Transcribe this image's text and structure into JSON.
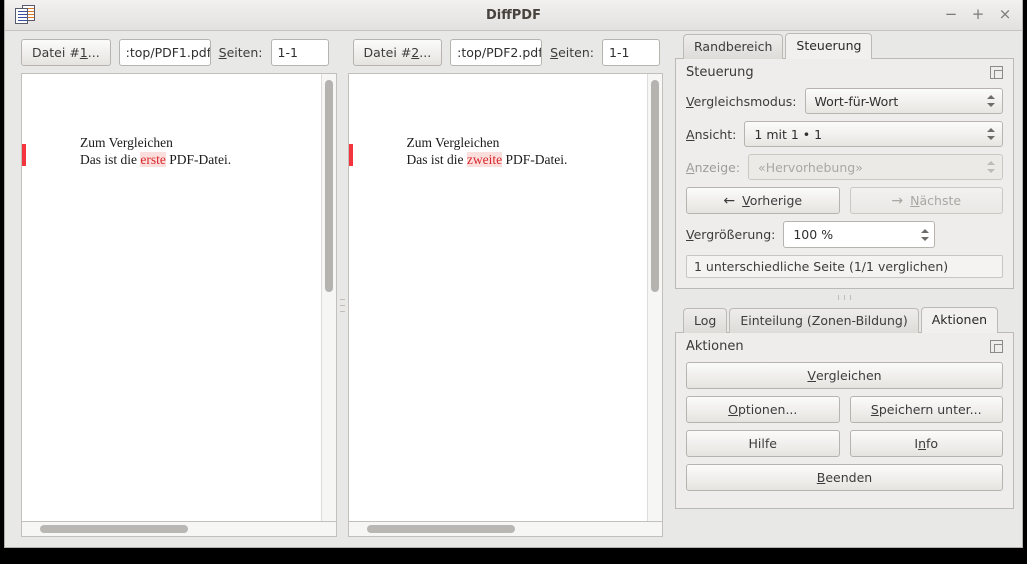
{
  "window": {
    "title": "DiffPDF",
    "icon": "documents-icon",
    "buttons": {
      "minimize": "−",
      "maximize": "+",
      "close": "×"
    }
  },
  "toolbar": {
    "file1": {
      "button_label": "Datei #1...",
      "button_mnemonic": "1",
      "filename": ":top/PDF1.pdf",
      "pages_label": "Seiten:",
      "pages_mnemonic": "S",
      "pages_value": "1-1"
    },
    "file2": {
      "button_label": "Datei #2...",
      "button_mnemonic": "2",
      "filename": ":top/PDF2.pdf",
      "pages_label": "Seiten:",
      "pages_mnemonic": "S",
      "pages_value": "1-1"
    }
  },
  "viewers": [
    {
      "name": "left-document-pane",
      "line1": "Zum Vergleichen",
      "line2_before": "Das ist die ",
      "line2_highlight": "erste",
      "line2_after": " PDF-Datei.",
      "has_diff_marker": true
    },
    {
      "name": "right-document-pane",
      "line1": "Zum Vergleichen",
      "line2_before": "Das ist die ",
      "line2_highlight": "zweite",
      "line2_after": " PDF-Datei.",
      "has_diff_marker": true
    }
  ],
  "colors": {
    "diff_marker": "#f4353e",
    "highlight_bg": "#fcdfdc",
    "highlight_text": "#d8252b",
    "window_bg": "#e8e8e7"
  },
  "top_dock": {
    "tabs": [
      {
        "label": "Randbereich",
        "active": false
      },
      {
        "label": "Steuerung",
        "active": true
      }
    ],
    "panel_title": "Steuerung",
    "float_icon": "undock-icon",
    "fields": {
      "mode_label": "Vergleichsmodus:",
      "mode_mnemonic": "V",
      "mode_value": "Wort-für-Wort",
      "view_label": "Ansicht:",
      "view_mnemonic": "A",
      "view_value": "1 mit 1 • 1",
      "display_label": "Anzeige:",
      "display_mnemonic": "A",
      "display_value": "«Hervorhebung»",
      "display_disabled": true,
      "zoom_label": "Vergrößerung:",
      "zoom_mnemonic": "V",
      "zoom_value": "100 %"
    },
    "nav": {
      "prev_label": "Vorherige",
      "prev_mnemonic": "V",
      "prev_arrow": "←",
      "next_label": "Nächste",
      "next_mnemonic": "N",
      "next_arrow": "→",
      "next_disabled": true
    },
    "status": "1 unterschiedliche Seite (1/1 verglichen)"
  },
  "bottom_dock": {
    "tabs": [
      {
        "label": "Log",
        "active": false
      },
      {
        "label": "Einteilung (Zonen-Bildung)",
        "active": false
      },
      {
        "label": "Aktionen",
        "active": true
      }
    ],
    "panel_title": "Aktionen",
    "float_icon": "undock-icon",
    "buttons": {
      "compare": "Vergleichen",
      "compare_mnemonic": "V",
      "options": "Optionen...",
      "options_mnemonic": "O",
      "save_as": "Speichern unter...",
      "save_as_mnemonic": "S",
      "help": "Hilfe",
      "help_mnemonic": "",
      "info": "Info",
      "info_mnemonic": "n",
      "quit": "Beenden",
      "quit_mnemonic": "B"
    }
  }
}
